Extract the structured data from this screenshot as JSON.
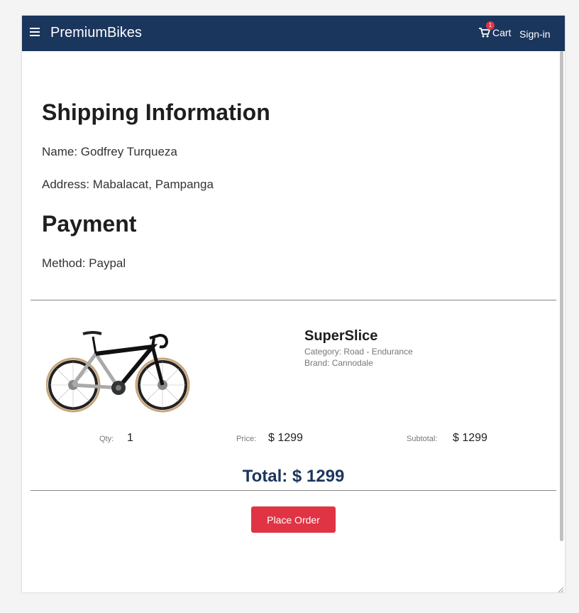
{
  "navbar": {
    "brand": "PremiumBikes",
    "cart_label": "Cart",
    "cart_count": "1",
    "signin_label": "Sign-in",
    "background": "#1b365d"
  },
  "shipping": {
    "title": "Shipping Information",
    "name_line": "Name: Godfrey Turqueza",
    "address_line": "Address: Mabalacat, Pampanga"
  },
  "payment": {
    "title": "Payment",
    "method_line": "Method: Paypal"
  },
  "product": {
    "name": "SuperSlice",
    "category_line": "Category: Road - Endurance",
    "brand_line": "Brand: Cannodale",
    "qty_label": "Qty:",
    "qty_value": "1",
    "price_label": "Price:",
    "price_value": "$ 1299",
    "subtotal_label": "Subtotal:",
    "subtotal_value": "$ 1299",
    "image_icon": "road-bike-image"
  },
  "summary": {
    "total": "Total: $ 1299",
    "place_order_label": "Place Order",
    "accent": "#e03444"
  }
}
